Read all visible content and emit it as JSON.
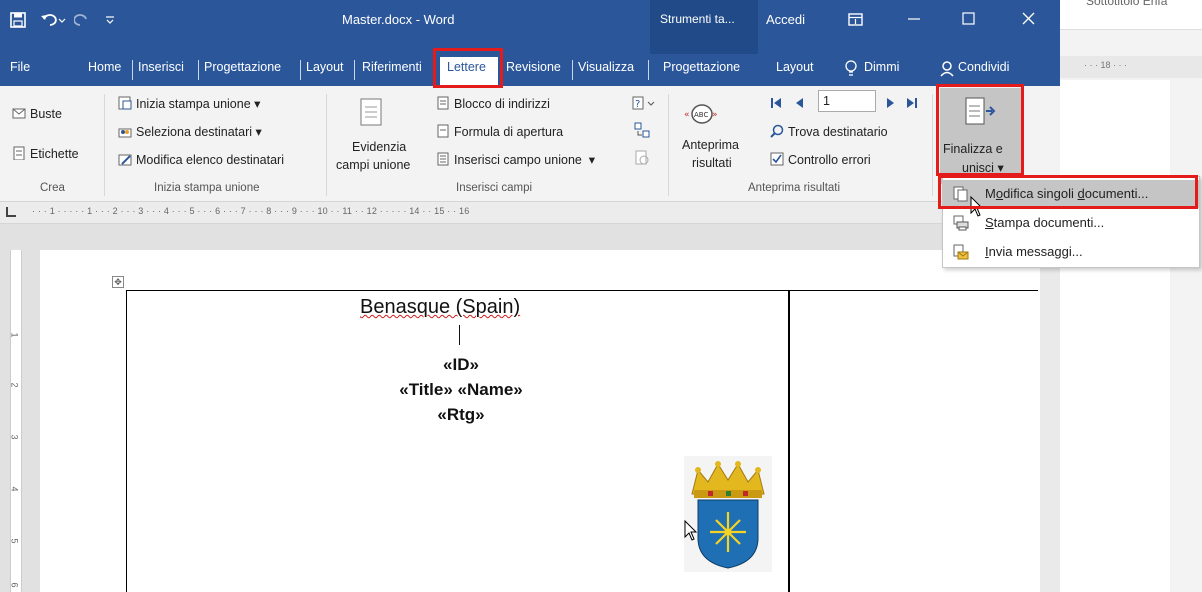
{
  "window": {
    "title": "Master.docx - Word",
    "context_tab": "Strumenti ta...",
    "signin": "Accedi"
  },
  "background_window": {
    "partial_text": "Sottotitolo  Enfa",
    "ruler_text": "· · · 18 · · ·"
  },
  "tabs": [
    "File",
    "Home",
    "Inserisci",
    "Progettazione",
    "Layout",
    "Riferimenti",
    "Lettere",
    "Revisione",
    "Visualizza",
    "Progettazione",
    "Layout"
  ],
  "tell_me": "Dimmi",
  "share": "Condividi",
  "ribbon": {
    "crea": {
      "buste": "Buste",
      "etichette": "Etichette",
      "group": "Crea"
    },
    "inizia": {
      "inizia_stampa": "Inizia stampa unione",
      "seleziona": "Seleziona destinatari",
      "modifica_elenco": "Modifica elenco destinatari",
      "group": "Inizia stampa unione"
    },
    "campi": {
      "evidenzia_1": "Evidenzia",
      "evidenzia_2": "campi unione",
      "blocco": "Blocco di indirizzi",
      "formula": "Formula di apertura",
      "inserisci_campo": "Inserisci campo unione",
      "group": "Inserisci campi"
    },
    "anteprima": {
      "anteprima_1": "Anteprima",
      "anteprima_2": "risultati",
      "record": "1",
      "trova": "Trova destinatario",
      "controllo": "Controllo errori",
      "group": "Anteprima risultati"
    },
    "finalizza": {
      "label_1": "Finalizza e",
      "label_2": "unisci"
    }
  },
  "ruler_text": "· · · 1 · · · · · 1 · · · 2 · · · 3 · · · 4 · · · 5 · · · 6 · · · 7 · · · 8 · · · 9 · · · 10 · · 11 · · 12 · · · · · 14 · · 15 · · 16",
  "vruler_numbers": [
    "1",
    "2",
    "3",
    "4",
    "5",
    "6"
  ],
  "document": {
    "heading": "Benasque (Spain)",
    "field_id": "«ID»",
    "field_title_name": "«Title» «Name»",
    "field_rtg": "«Rtg»"
  },
  "menu": {
    "items": [
      {
        "pre": "M",
        "ul": "o",
        "mid": "difica singoli ",
        "ul2": "d",
        "post": "ocumenti..."
      },
      {
        "pre": "",
        "ul": "S",
        "mid": "tampa documenti...",
        "ul2": "",
        "post": ""
      },
      {
        "pre": "",
        "ul": "I",
        "mid": "nvia messaggi...",
        "ul2": "",
        "post": ""
      }
    ]
  },
  "colors": {
    "word_blue": "#2b579a",
    "highlight_red": "#e31b1b",
    "menu_hover": "#c5c5c5"
  }
}
